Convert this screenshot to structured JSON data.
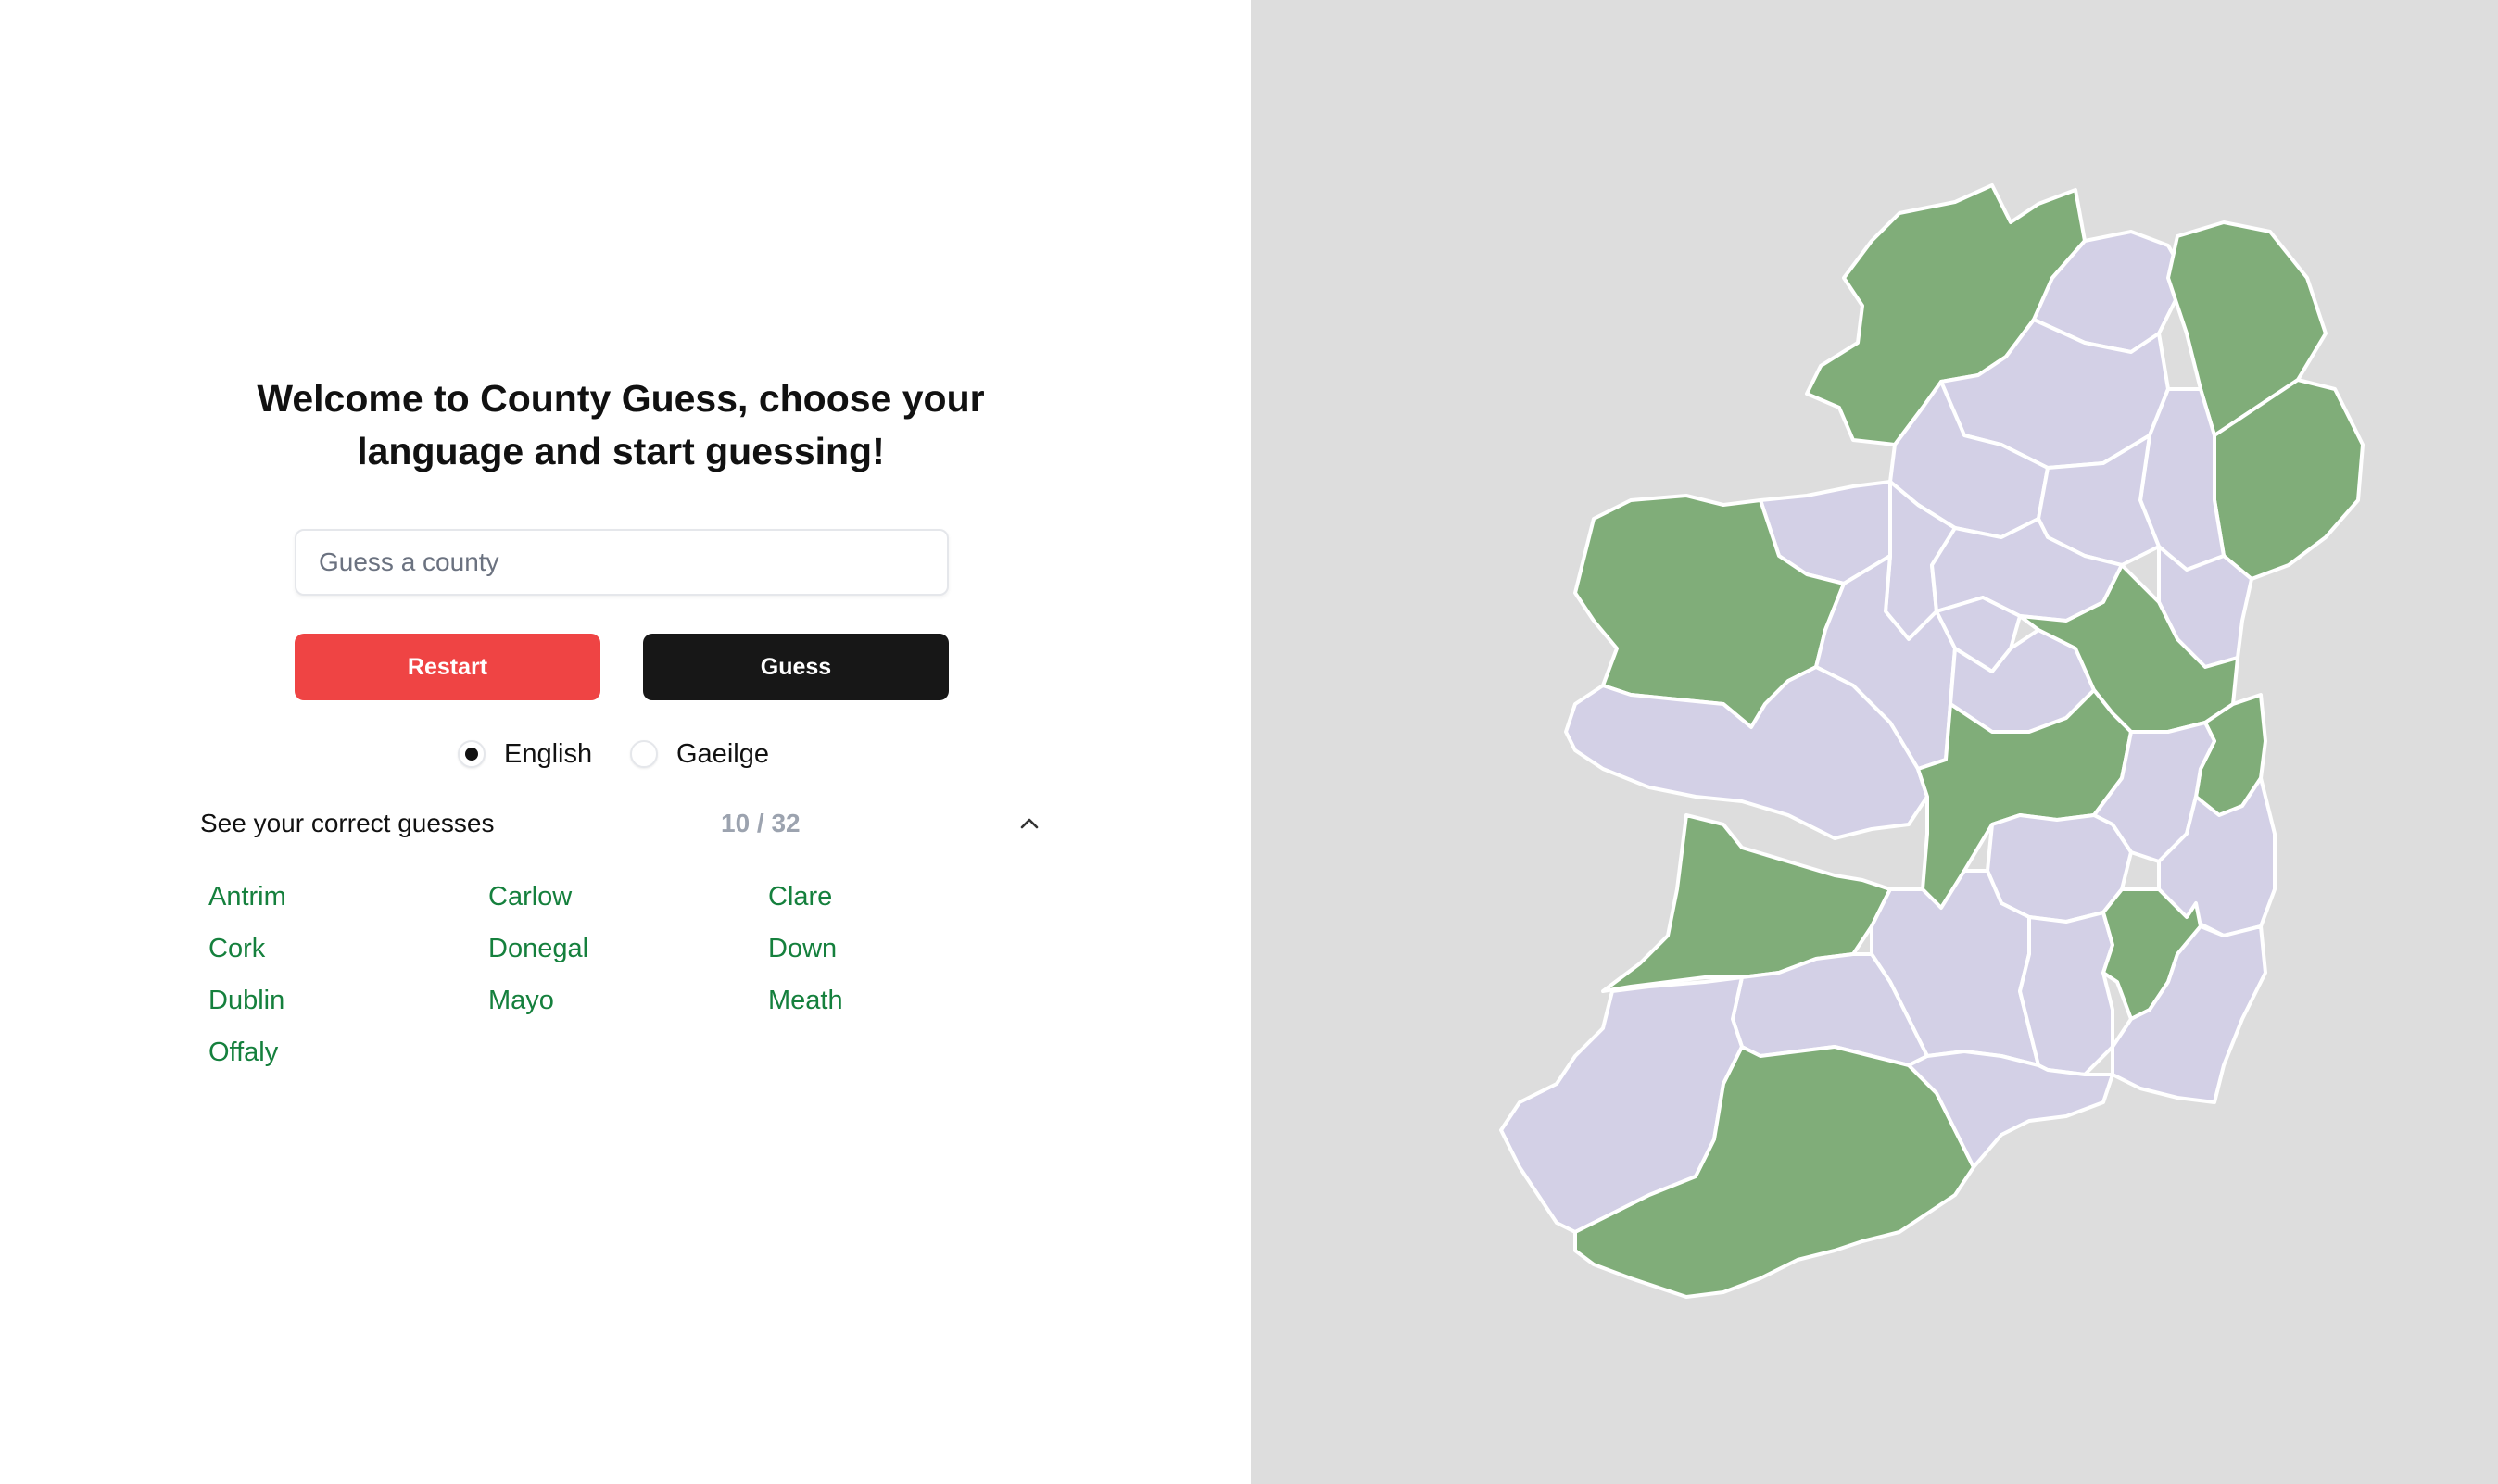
{
  "title": "Welcome to County Guess, choose your language and start guessing!",
  "search": {
    "placeholder": "Guess a county",
    "value": ""
  },
  "buttons": {
    "restart": "Restart",
    "guess": "Guess"
  },
  "languages": {
    "english": "English",
    "irish": "Gaeilge",
    "selected": "English"
  },
  "guesses": {
    "title": "See your correct guesses",
    "count": "10 / 32",
    "expanded": true,
    "items": [
      "Antrim",
      "Carlow",
      "Clare",
      "Cork",
      "Donegal",
      "Down",
      "Dublin",
      "Mayo",
      "Meath",
      "Offaly"
    ]
  },
  "map": {
    "zoom_in_label": "+",
    "zoom_out_label": "−",
    "colors": {
      "guessed": "#80ad79",
      "unguessed": "#d3d0e6",
      "background": "#dddddd",
      "border": "#ffffff"
    },
    "icons": [
      "plus-icon",
      "minus-icon",
      "chevron-up-icon"
    ]
  }
}
